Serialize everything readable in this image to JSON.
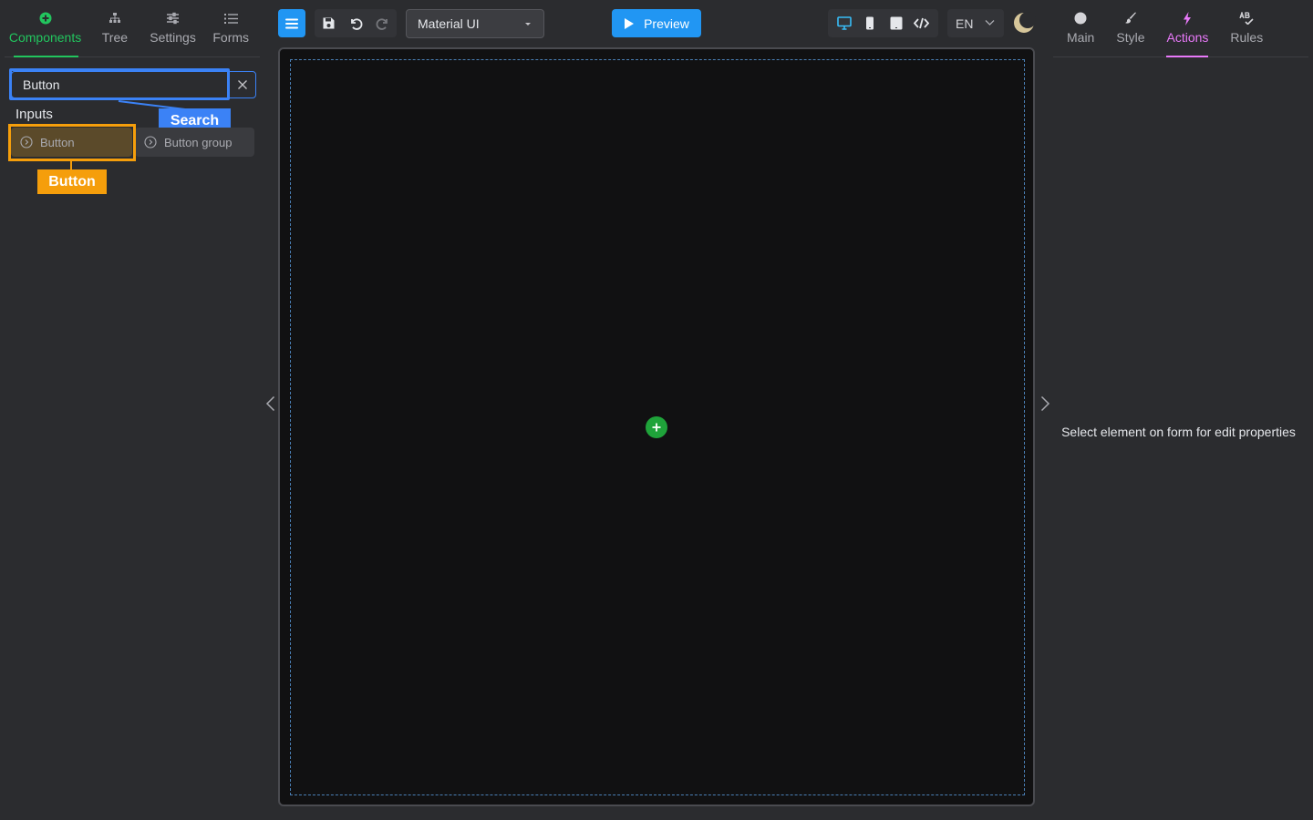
{
  "left_tabs": [
    {
      "label": "Components",
      "icon": "plus-circle-icon",
      "active": true
    },
    {
      "label": "Tree",
      "icon": "sitemap-icon"
    },
    {
      "label": "Settings",
      "icon": "sliders-icon"
    },
    {
      "label": "Forms",
      "icon": "list-icon"
    }
  ],
  "search": {
    "value": "Button",
    "highlight_label": "Search"
  },
  "components": {
    "group_title": "Inputs",
    "items": [
      {
        "label": "Button"
      },
      {
        "label": "Button group"
      }
    ],
    "highlight_label": "Button"
  },
  "toolbar": {
    "theme": "Material UI",
    "preview_label": "Preview",
    "language": "EN"
  },
  "right_tabs": [
    {
      "label": "Main",
      "icon": "circle-icon"
    },
    {
      "label": "Style",
      "icon": "brush-icon"
    },
    {
      "label": "Actions",
      "icon": "bolt-icon",
      "active": true
    },
    {
      "label": "Rules",
      "icon": "spellcheck-icon"
    }
  ],
  "properties_hint": "Select element on form for edit properties",
  "colors": {
    "accent_green": "#22c55e",
    "accent_blue": "#2196f3",
    "accent_pink": "#e879f9",
    "highlight_orange": "#f59e0b"
  }
}
